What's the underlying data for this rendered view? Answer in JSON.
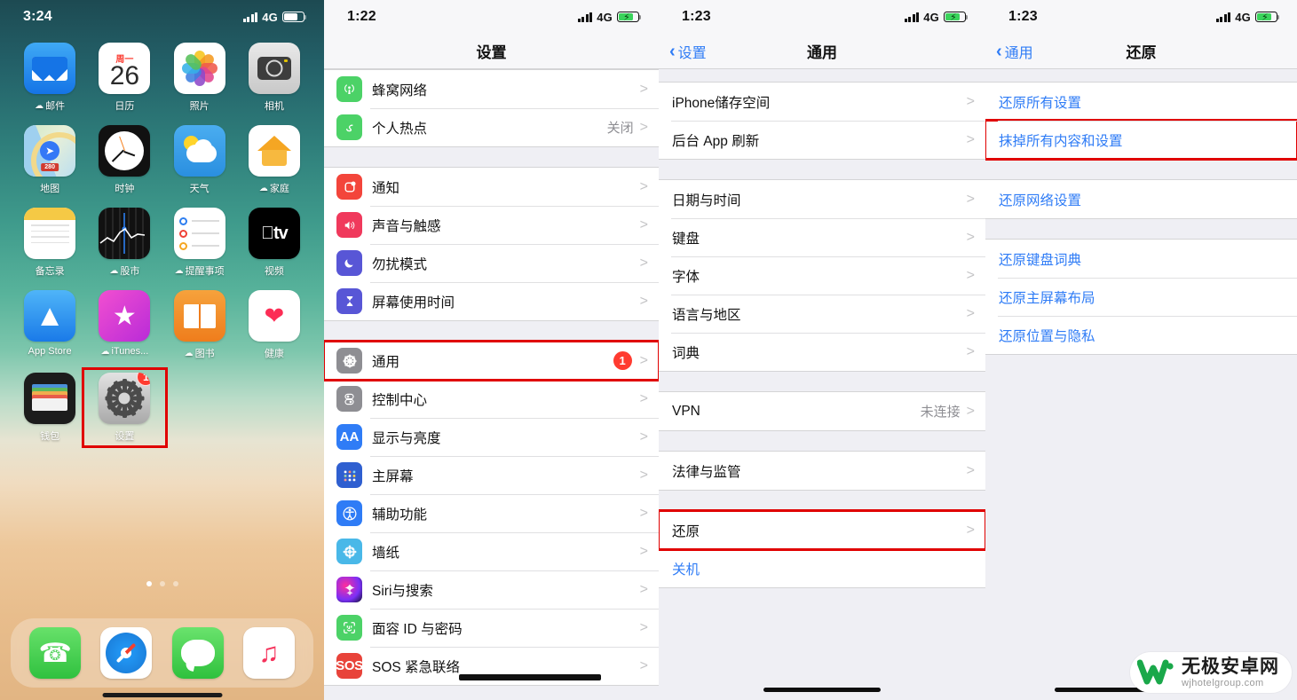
{
  "panels": {
    "home": {
      "status": {
        "time": "3:24",
        "network": "4G",
        "signal_icon": "signal-bars-icon",
        "battery_icon": "battery-icon"
      },
      "apps": [
        {
          "name": "邮件",
          "icon": "mail-icon",
          "cloud": true
        },
        {
          "name": "日历",
          "icon": "calendar-icon",
          "weekday": "周一",
          "day": "26",
          "cloud": false
        },
        {
          "name": "照片",
          "icon": "photos-icon",
          "cloud": false
        },
        {
          "name": "相机",
          "icon": "camera-icon",
          "cloud": false
        },
        {
          "name": "地图",
          "icon": "maps-icon",
          "badge_text": "280",
          "cloud": false
        },
        {
          "name": "时钟",
          "icon": "clock-icon",
          "cloud": false
        },
        {
          "name": "天气",
          "icon": "weather-icon",
          "cloud": false
        },
        {
          "name": "家庭",
          "icon": "home-app-icon",
          "cloud": true
        },
        {
          "name": "备忘录",
          "icon": "notes-icon",
          "cloud": false
        },
        {
          "name": "股市",
          "icon": "stocks-icon",
          "cloud": true
        },
        {
          "name": "提醒事项",
          "icon": "reminders-icon",
          "cloud": true
        },
        {
          "name": "视频",
          "icon": "apple-tv-icon",
          "logo": "tv",
          "cloud": false
        },
        {
          "name": "App Store",
          "icon": "app-store-icon",
          "cloud": false
        },
        {
          "name": "iTunes...",
          "icon": "itunes-store-icon",
          "cloud": true
        },
        {
          "name": "图书",
          "icon": "books-icon",
          "cloud": true
        },
        {
          "name": "健康",
          "icon": "health-icon",
          "cloud": false
        },
        {
          "name": "钱包",
          "icon": "wallet-icon",
          "cloud": false
        },
        {
          "name": "设置",
          "icon": "settings-gear-icon",
          "badge": "1",
          "cloud": false,
          "highlighted": true
        }
      ],
      "page_dots": {
        "count": 3,
        "active_index": 0
      },
      "dock": [
        {
          "name": "电话",
          "icon": "phone-icon"
        },
        {
          "name": "Safari",
          "icon": "safari-compass-icon"
        },
        {
          "name": "信息",
          "icon": "messages-icon"
        },
        {
          "name": "音乐",
          "icon": "music-note-icon"
        }
      ]
    },
    "settings": {
      "status": {
        "time": "1:22",
        "network": "4G",
        "signal_icon": "signal-bars-icon",
        "battery_icon": "battery-charging-icon"
      },
      "title": "设置",
      "groups": [
        {
          "rows": [
            {
              "label": "蜂窝网络",
              "icon": "cellular-icon",
              "chevron": ">"
            },
            {
              "label": "个人热点",
              "icon": "personal-hotspot-icon",
              "value": "关闭",
              "chevron": ">"
            }
          ]
        },
        {
          "rows": [
            {
              "label": "通知",
              "icon": "notifications-icon",
              "chevron": ">"
            },
            {
              "label": "声音与触感",
              "icon": "sounds-haptics-icon",
              "chevron": ">"
            },
            {
              "label": "勿扰模式",
              "icon": "do-not-disturb-icon",
              "chevron": ">"
            },
            {
              "label": "屏幕使用时间",
              "icon": "screen-time-icon",
              "chevron": ">"
            }
          ]
        },
        {
          "rows": [
            {
              "label": "通用",
              "icon": "general-gear-icon",
              "badge": "1",
              "chevron": ">",
              "highlighted": true
            },
            {
              "label": "控制中心",
              "icon": "control-center-icon",
              "chevron": ">"
            },
            {
              "label": "显示与亮度",
              "icon": "display-brightness-icon",
              "icon_text": "AA",
              "chevron": ">"
            },
            {
              "label": "主屏幕",
              "icon": "home-screen-icon",
              "chevron": ">"
            },
            {
              "label": "辅助功能",
              "icon": "accessibility-icon",
              "chevron": ">"
            },
            {
              "label": "墙纸",
              "icon": "wallpaper-icon",
              "chevron": ">"
            },
            {
              "label": "Siri与搜索",
              "icon": "siri-icon",
              "chevron": ">"
            },
            {
              "label": "面容 ID 与密码",
              "icon": "face-id-icon",
              "chevron": ">"
            },
            {
              "label": "SOS 紧急联络",
              "icon": "emergency-sos-icon",
              "icon_text": "SOS",
              "chevron": ">"
            }
          ]
        }
      ]
    },
    "general": {
      "status": {
        "time": "1:23",
        "network": "4G",
        "signal_icon": "signal-bars-icon",
        "battery_icon": "battery-charging-icon"
      },
      "back_label": "设置",
      "title": "通用",
      "groups": [
        {
          "rows": [
            {
              "label": "iPhone储存空间",
              "chevron": ">"
            },
            {
              "label": "后台 App 刷新",
              "chevron": ">"
            }
          ]
        },
        {
          "rows": [
            {
              "label": "日期与时间",
              "chevron": ">"
            },
            {
              "label": "键盘",
              "chevron": ">"
            },
            {
              "label": "字体",
              "chevron": ">"
            },
            {
              "label": "语言与地区",
              "chevron": ">"
            },
            {
              "label": "词典",
              "chevron": ">"
            }
          ]
        },
        {
          "rows": [
            {
              "label": "VPN",
              "value": "未连接",
              "chevron": ">"
            }
          ]
        },
        {
          "rows": [
            {
              "label": "法律与监管",
              "chevron": ">"
            }
          ]
        },
        {
          "rows": [
            {
              "label": "还原",
              "chevron": ">",
              "highlighted": true
            },
            {
              "label": "关机",
              "blue": true
            }
          ]
        }
      ]
    },
    "reset": {
      "status": {
        "time": "1:23",
        "network": "4G",
        "signal_icon": "signal-bars-icon",
        "battery_icon": "battery-charging-icon"
      },
      "back_label": "通用",
      "title": "还原",
      "groups": [
        {
          "rows": [
            {
              "label": "还原所有设置",
              "blue": true
            },
            {
              "label": "抹掉所有内容和设置",
              "blue": true,
              "highlighted": true
            }
          ]
        },
        {
          "rows": [
            {
              "label": "还原网络设置",
              "blue": true
            }
          ]
        },
        {
          "rows": [
            {
              "label": "还原键盘词典",
              "blue": true
            },
            {
              "label": "还原主屏幕布局",
              "blue": true
            },
            {
              "label": "还原位置与隐私",
              "blue": true
            }
          ]
        }
      ]
    }
  },
  "watermark": {
    "brand_cn": "无极安卓网",
    "brand_en": "wjhotelgroup.com",
    "logo": "w-mark-icon"
  },
  "colors": {
    "accent_blue": "#2f7cf6",
    "highlight_red": "#e00000",
    "badge_red": "#ff3b30",
    "list_bg": "#efeff4",
    "row_bg": "#ffffff",
    "muted_text": "#8e8e93"
  }
}
